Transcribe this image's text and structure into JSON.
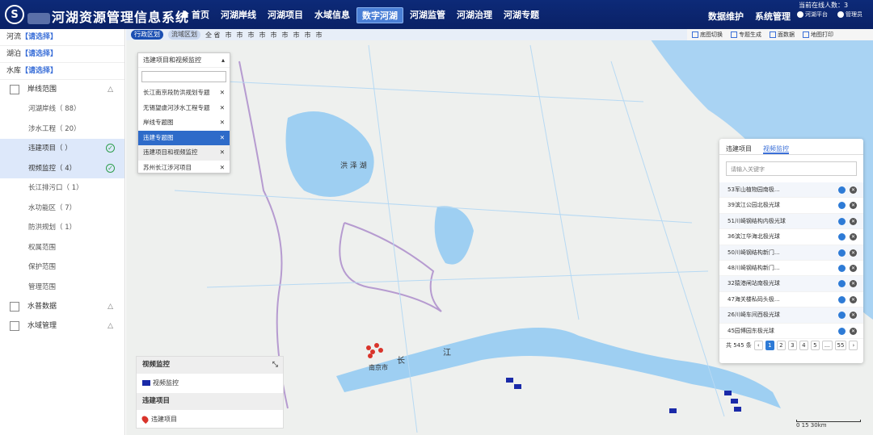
{
  "header": {
    "title": "河湖资源管理信息系统",
    "logo_letter": "S",
    "nav": [
      {
        "label": "首页",
        "home": true
      },
      {
        "label": "河湖岸线"
      },
      {
        "label": "河湖项目"
      },
      {
        "label": "水域信息"
      },
      {
        "label": "数字河湖",
        "active": true
      },
      {
        "label": "河湖监管"
      },
      {
        "label": "河湖治理"
      },
      {
        "label": "河湖专题"
      }
    ],
    "right_nav": [
      "数据维护",
      "系统管理"
    ],
    "online_label": "当前在线人数：",
    "online_count": "3",
    "platform": "河湖平台",
    "user": "管理员"
  },
  "sidebar": {
    "filters": [
      {
        "label": "河流",
        "value": "【请选择】"
      },
      {
        "label": "湖泊",
        "value": "【请选择】"
      },
      {
        "label": "水库",
        "value": "【请选择】"
      }
    ],
    "groups": [
      {
        "label": "岸线范围",
        "items": [
          {
            "label": "河湖岸线（  88）"
          },
          {
            "label": "涉水工程（  20）"
          },
          {
            "label": "违建项目（  ）",
            "active": true,
            "checked": true
          },
          {
            "label": "视频监控（  4）",
            "active": true,
            "checked": true
          },
          {
            "label": "长江排污口（  1）"
          },
          {
            "label": "水功能区（  7）"
          },
          {
            "label": "防洪规划（  1）"
          },
          {
            "label": "权属范围"
          },
          {
            "label": "保护范围"
          },
          {
            "label": "管理范围"
          }
        ]
      },
      {
        "label": "水普数据",
        "items": []
      },
      {
        "label": "水域管理",
        "items": []
      }
    ]
  },
  "regionbar": {
    "tabs": [
      "行政区划",
      "流域区划"
    ],
    "items": [
      "全 省",
      "市",
      "市",
      "市",
      "市",
      "市",
      "市",
      "市",
      "市",
      "市"
    ]
  },
  "tools": [
    "底图切换",
    "专题生成",
    "面数据",
    "地图打印"
  ],
  "dropdown": {
    "selected": "违建项目和视频监控",
    "items": [
      {
        "label": "长江南京段防洪规划专题"
      },
      {
        "label": "无锡望虞河涉水工程专题"
      },
      {
        "label": "岸线专题图"
      },
      {
        "label": "违建专题图",
        "highlight": true
      },
      {
        "label": "违建项目和视频监控",
        "selected": true
      },
      {
        "label": "苏州长江涉河项目"
      }
    ]
  },
  "panel": {
    "tabs": [
      "违建项目",
      "视频监控"
    ],
    "search_placeholder": "请输入关键字",
    "items": [
      "53军山植物园南极...",
      "39滨江公园北极光球",
      "51川崎钢结构内极光球",
      "36滨江华海北极光球",
      "50川崎钢结构新门...",
      "48川崎钢结构新门...",
      "32猿港闸站南极光球",
      "47海关楼私码头极...",
      "26川崎车间西极光球",
      "45园博园东极光球"
    ],
    "total": "共 545 条",
    "pages": [
      "‹",
      "1",
      "2",
      "3",
      "4",
      "5",
      "...",
      "55",
      "›"
    ]
  },
  "legend": {
    "video_title": "视频监控",
    "video_label": "视频监控",
    "project_title": "违建项目",
    "project_label": "违建项目"
  },
  "map_labels": {
    "lake": "洪 泽 湖",
    "city": "南京市",
    "river1": "长",
    "river2": "江",
    "scale": "0      15     30km"
  }
}
